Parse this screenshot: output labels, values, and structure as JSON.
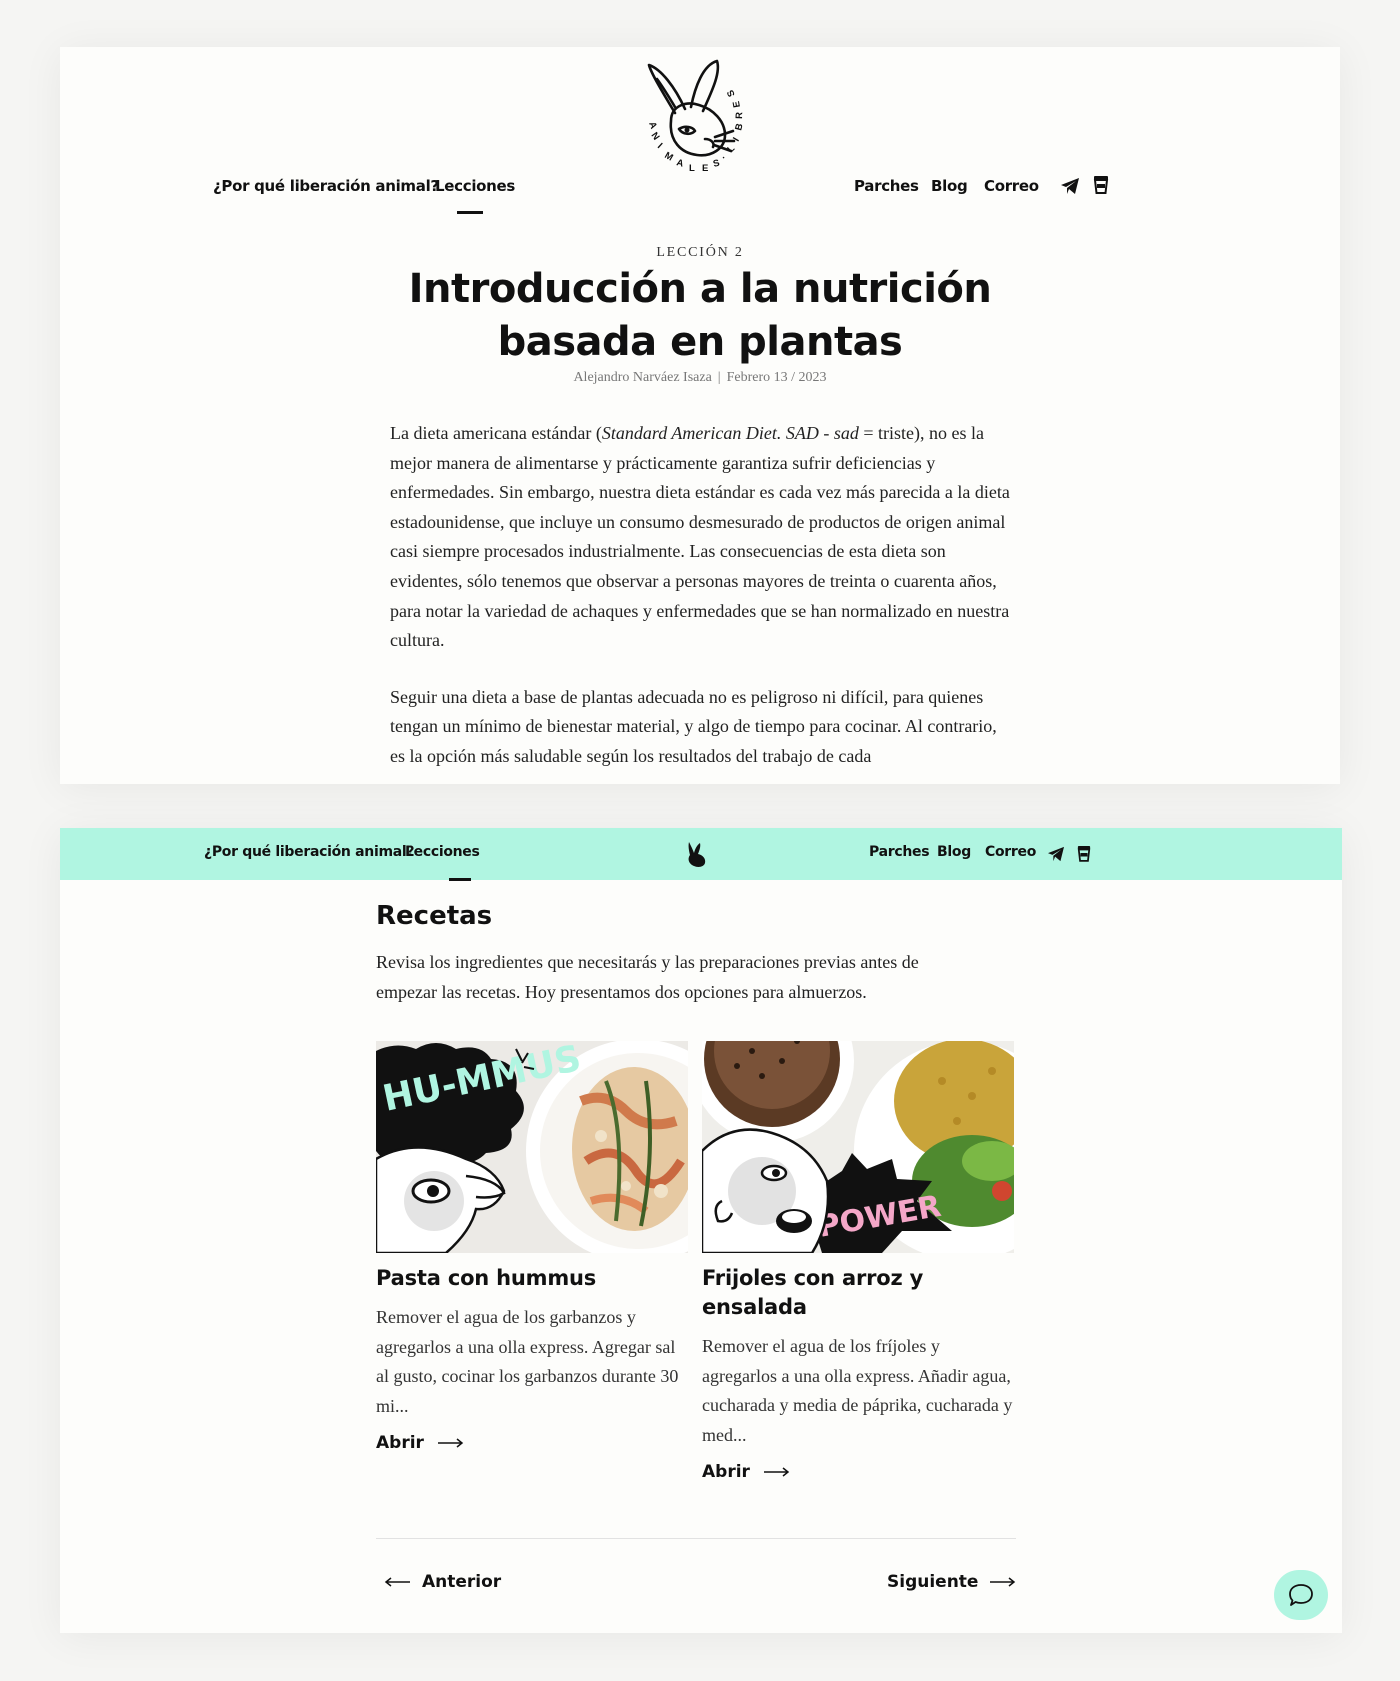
{
  "header": {
    "nav_left": [
      "¿Por qué liberación animal?",
      "Lecciones"
    ],
    "nav_right": [
      "Parches",
      "Blog",
      "Correo"
    ],
    "logo_text": "ANIMALES LIBRES",
    "icons": [
      "telegram-icon",
      "coffee-cup-icon"
    ]
  },
  "lesson": {
    "kicker": "LECCIÓN 2",
    "title_line1": "Introducción a la nutrición",
    "title_line2": "basada en plantas",
    "author": "Alejandro Narváez Isaza",
    "date": "Febrero 13 / 2023",
    "p1_a": "La dieta americana estándar (",
    "p1_em": "Standard American Diet. SAD - sad",
    "p1_b": " = triste), no es la mejor manera de alimentarse y prácticamente garantiza sufrir deficiencias y enfermedades. Sin embargo, nuestra dieta estándar es cada vez más parecida a la dieta estadounidense, que incluye un consumo desmesurado de productos de origen animal casi siempre procesados industrialmente. Las consecuencias de esta dieta son evidentes, sólo tenemos que observar a personas mayores de treinta o cuarenta años, para notar la variedad de achaques y enfermedades que se han normalizado en nuestra cultura.",
    "p2": "Seguir una dieta a base de plantas adecuada no es peligroso ni difícil, para quienes tengan un mínimo de bienestar material, y algo de tiempo para cocinar. Al contrario, es la opción más saludable según los resultados del trabajo de cada"
  },
  "recipes": {
    "title": "Recetas",
    "intro": "Revisa los ingredientes que necesitarás y las preparaciones previas antes de empezar las recetas. Hoy presentamos dos opciones para almuerzos.",
    "cards": [
      {
        "badge": "HU-MMUS",
        "title": "Pasta con hummus",
        "excerpt": "Remover el agua de los garbanzos y agregarlos a una olla express. Agregar sal al gusto, cocinar los garbanzos durante 30 mi...",
        "link": "Abrir"
      },
      {
        "badge": "POWER",
        "title": "Frijoles con arroz y ensalada",
        "excerpt": "Remover el agua de los fríjoles y agregarlos a una olla express. Añadir agua, cucharada y media de páprika, cucharada y med...",
        "link": "Abrir"
      }
    ]
  },
  "pagination": {
    "prev": "Anterior",
    "next": "Siguiente"
  },
  "colors": {
    "mint": "#b0f5e1",
    "pink": "#f4a7c8",
    "ink": "#111111"
  }
}
